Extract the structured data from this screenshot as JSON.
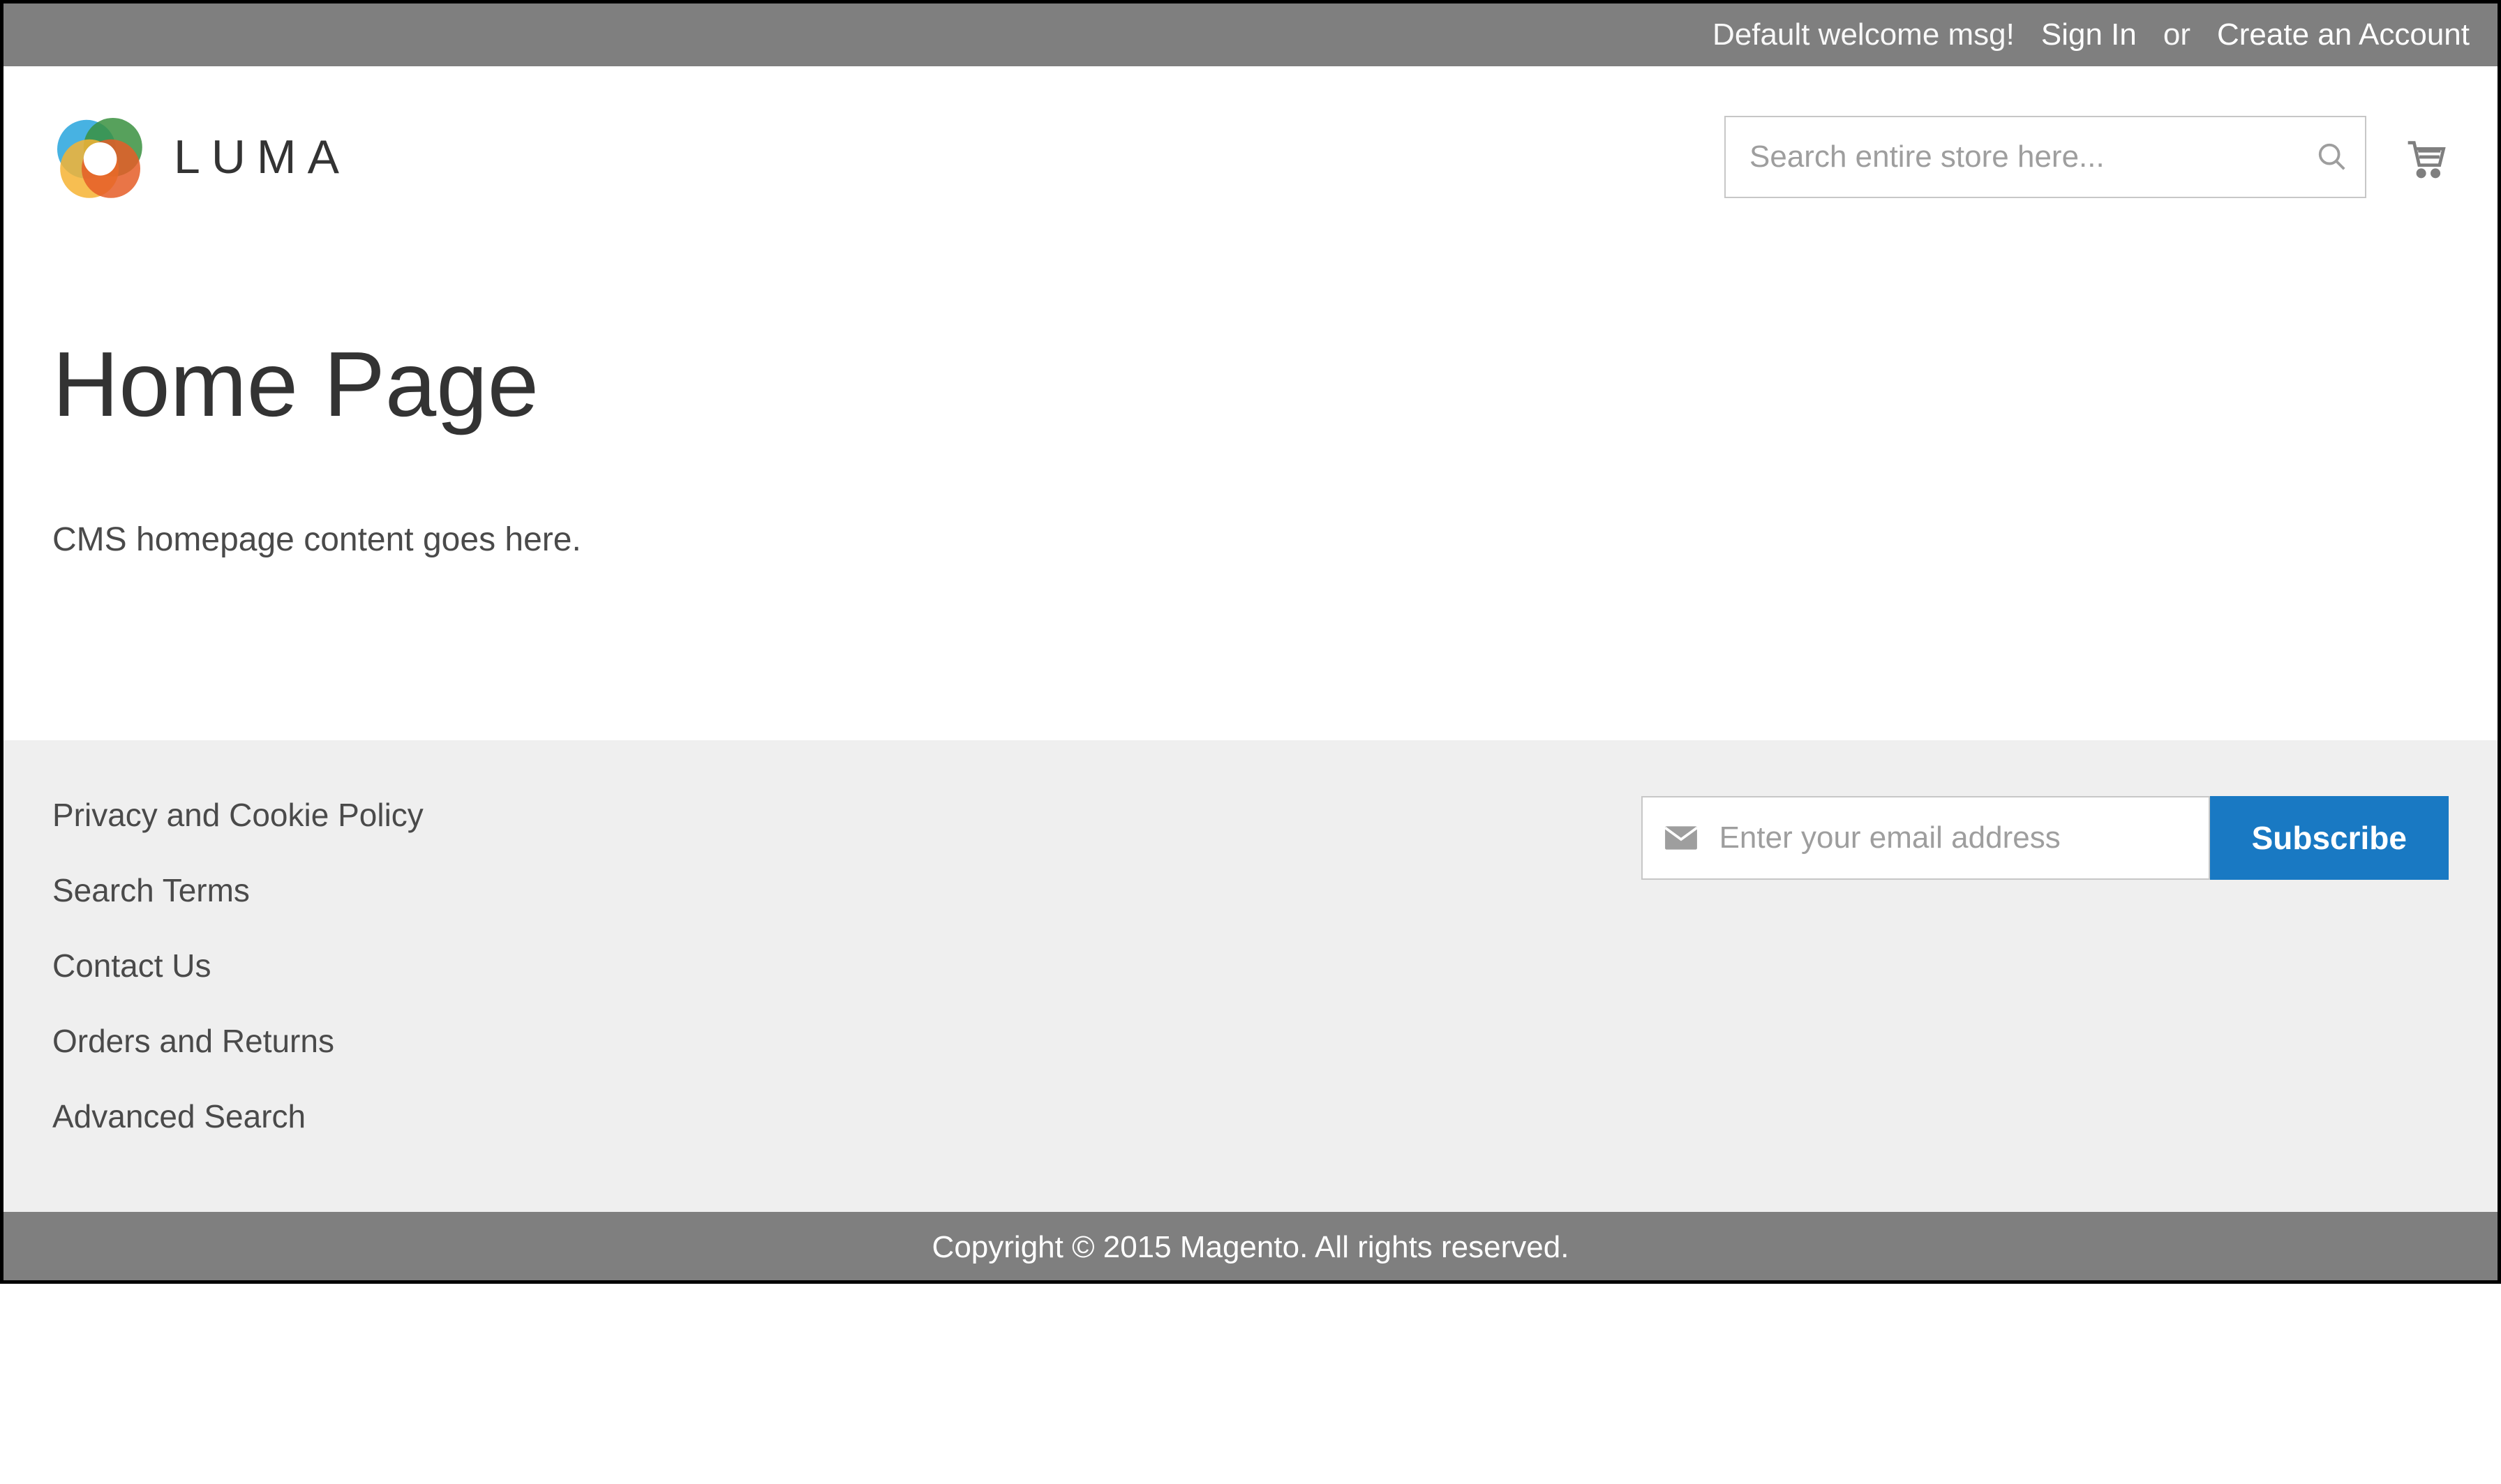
{
  "topbar": {
    "welcome_msg": "Default welcome msg!",
    "sign_in_label": "Sign In",
    "or_label": "or",
    "create_account_label": "Create an Account"
  },
  "header": {
    "brand_name": "LUMA",
    "search_placeholder": "Search entire store here..."
  },
  "main": {
    "page_title": "Home Page",
    "cms_content": "CMS homepage content goes here."
  },
  "footer": {
    "links": [
      "Privacy and Cookie Policy",
      "Search Terms",
      "Contact Us",
      "Orders and Returns",
      "Advanced Search"
    ],
    "newsletter_placeholder": "Enter your email address",
    "subscribe_label": "Subscribe"
  },
  "copyright": "Copyright © 2015 Magento. All rights reserved.",
  "colors": {
    "topbar_bg": "#7f7f7f",
    "subscribe_btn_bg": "#1979c3",
    "footer_bg": "#efefef"
  }
}
